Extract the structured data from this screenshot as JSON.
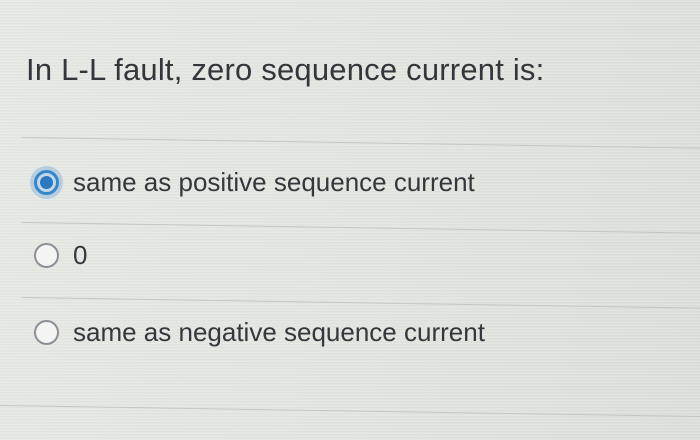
{
  "question": {
    "text": "In L-L fault, zero sequence current is:"
  },
  "options": [
    {
      "label": "same as positive sequence current",
      "selected": true
    },
    {
      "label": "0",
      "selected": false
    },
    {
      "label": "same as negative sequence current",
      "selected": false
    }
  ],
  "colors": {
    "accent": "#2b78c2",
    "text": "#34383c",
    "background": "#e4e6e2"
  }
}
